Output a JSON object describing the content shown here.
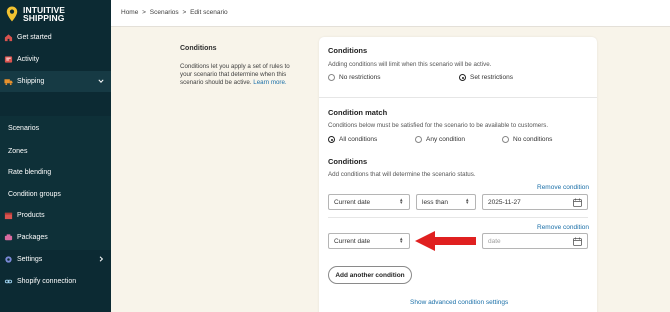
{
  "brand": {
    "line1": "INTUITIVE",
    "line2": "SHIPPING",
    "accent": "#f2c230"
  },
  "sidebar": {
    "items": [
      {
        "label": "Get started",
        "icon": "home-icon"
      },
      {
        "label": "Activity",
        "icon": "activity-icon"
      },
      {
        "label": "Shipping",
        "icon": "truck-icon"
      },
      {
        "label": "Scenarios"
      },
      {
        "label": "Zones"
      },
      {
        "label": "Rate blending"
      },
      {
        "label": "Condition groups"
      },
      {
        "label": "Products",
        "icon": "box-icon"
      },
      {
        "label": "Packages",
        "icon": "package-icon"
      },
      {
        "label": "Settings",
        "icon": "gear-icon"
      },
      {
        "label": "Shopify connection",
        "icon": "link-icon"
      }
    ]
  },
  "breadcrumb": {
    "home": "Home",
    "sep1": ">",
    "scenarios": "Scenarios",
    "sep2": ">",
    "current": "Edit scenario"
  },
  "left_panel": {
    "title": "Conditions",
    "description": "Conditions let you apply a set of rules to your scenario that determine when this scenario should be active.",
    "learn_more": "Learn more."
  },
  "card": {
    "conditions_heading": "Conditions",
    "conditions_desc": "Adding conditions will limit when this scenario will be active.",
    "restrict_options": [
      "No restrictions",
      "Set restrictions"
    ],
    "restrict_selected": "Set restrictions",
    "match_heading": "Condition match",
    "match_desc": "Conditions below must be satisfied for the scenario to be available to customers.",
    "match_options": [
      "All conditions",
      "Any condition",
      "No conditions"
    ],
    "match_selected": "All conditions",
    "list_heading": "Conditions",
    "list_desc": "Add conditions that will determine the scenario status.",
    "remove_label": "Remove condition",
    "condition1": {
      "field": "Current date",
      "operator": "less than",
      "value": "2025-11-27"
    },
    "condition2": {
      "field": "Current date",
      "value_placeholder": "date"
    },
    "add_button": "Add another condition",
    "advanced_link": "Show advanced condition settings"
  }
}
